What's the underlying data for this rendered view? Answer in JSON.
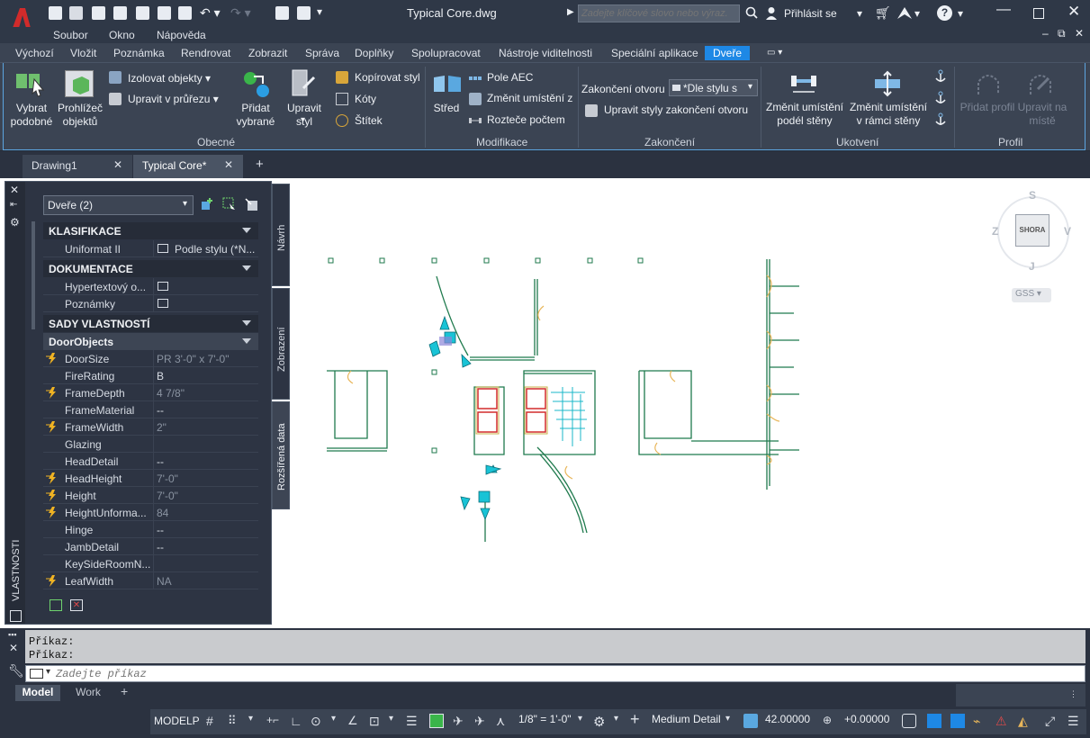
{
  "window": {
    "title": "Typical Core.dwg",
    "search_placeholder": "Zadejte klíčové slovo nebo výraz.",
    "signin_label": "Přihlásit se"
  },
  "menu": [
    "Soubor",
    "Okno",
    "Nápověda"
  ],
  "ribbon_tabs": [
    "Výchozí",
    "Vložit",
    "Poznámka",
    "Rendrovat",
    "Zobrazit",
    "Správa",
    "Doplňky",
    "Spolupracovat",
    "Nástroje viditelnosti",
    "Speciální aplikace",
    "Dveře"
  ],
  "ribbon": {
    "obecne": {
      "panel_label": "Obecné",
      "select_similar": "Vybrat podobné",
      "object_viewer": "Prohlížeč objektů",
      "isolate": "Izolovat objekty",
      "edit_in_section": "Upravit v průřezu",
      "add_selected": "Přidat vybrané",
      "edit_style": "Upravit styl",
      "copy_style": "Kopírovat styl",
      "dims": "Kóty",
      "tag": "Štítek"
    },
    "modifikace": {
      "panel_label": "Modifikace",
      "center": "Střed",
      "aec_array": "Pole AEC",
      "change_location": "Změnit umístění z",
      "spacing_count": "Rozteče počtem"
    },
    "zakonceni": {
      "panel_label": "Zakončení",
      "opening_end": "Zakončení otvoru",
      "style_dropdown": "*Dle stylu s",
      "edit_end_styles": "Upravit styly zakončení otvoru"
    },
    "ukotveni": {
      "panel_label": "Ukotvení",
      "along_wall": "Změnit umístění podél stěny",
      "within_wall": "Změnit umístění v rámci stěny"
    },
    "profil": {
      "panel_label": "Profil",
      "add_profile": "Přidat profil",
      "edit_in_place": "Upravit na místě"
    }
  },
  "doc_tabs": [
    "Drawing1",
    "Typical Core*"
  ],
  "palette": {
    "selector": "Dveře (2)",
    "title": "VLASTNOSTI",
    "side_tabs": [
      "Návrh",
      "Zobrazení",
      "Rozšířená data"
    ],
    "sections": {
      "klasifikace": "KLASIFIKACE",
      "dokumentace": "DOKUMENTACE",
      "sady": "SADY VLASTNOSTÍ",
      "doorobjects": "DoorObjects"
    },
    "klasifikace_rows": [
      {
        "name": "Uniformat II",
        "value": "Podle stylu (*N..."
      }
    ],
    "dokumentace_rows": [
      {
        "name": "Hypertextový o..."
      },
      {
        "name": "Poznámky"
      }
    ],
    "door_rows": [
      {
        "name": "DoorSize",
        "value": "PR 3'-0\" x 7'-0\"",
        "bolt": true,
        "dim": true
      },
      {
        "name": "FireRating",
        "value": "B",
        "bolt": false,
        "dim": false
      },
      {
        "name": "FrameDepth",
        "value": "4 7/8\"",
        "bolt": true,
        "dim": true
      },
      {
        "name": "FrameMaterial",
        "value": "--",
        "bolt": false,
        "dim": false
      },
      {
        "name": "FrameWidth",
        "value": "2\"",
        "bolt": true,
        "dim": true
      },
      {
        "name": "Glazing",
        "value": "",
        "bolt": false,
        "dim": false
      },
      {
        "name": "HeadDetail",
        "value": "--",
        "bolt": false,
        "dim": false
      },
      {
        "name": "HeadHeight",
        "value": "7'-0\"",
        "bolt": true,
        "dim": true
      },
      {
        "name": "Height",
        "value": "7'-0\"",
        "bolt": true,
        "dim": true
      },
      {
        "name": "HeightUnforma...",
        "value": "84",
        "bolt": true,
        "dim": true
      },
      {
        "name": "Hinge",
        "value": "--",
        "bolt": false,
        "dim": false
      },
      {
        "name": "JambDetail",
        "value": "--",
        "bolt": false,
        "dim": false
      },
      {
        "name": "KeySideRoomN...",
        "value": "",
        "bolt": false,
        "dim": false
      },
      {
        "name": "LeafWidth",
        "value": "NA",
        "bolt": true,
        "dim": true
      }
    ]
  },
  "viewcube": {
    "n": "S",
    "s": "J",
    "w": "Z",
    "e": "V",
    "face": "SHORA",
    "wcs": "GSS"
  },
  "command": {
    "history": [
      "Příkaz:",
      "Příkaz:"
    ],
    "placeholder": "Zadejte příkaz"
  },
  "layout_tabs": [
    "Model",
    "Work"
  ],
  "status": {
    "model": "MODELP",
    "scale": "1/8\" = 1'-0\"",
    "detail": "Medium Detail",
    "elevation": "42.00000",
    "offset": "+0.00000"
  },
  "colors": {
    "accent": "#1e88e5",
    "brand_red": "#d22b2b"
  }
}
